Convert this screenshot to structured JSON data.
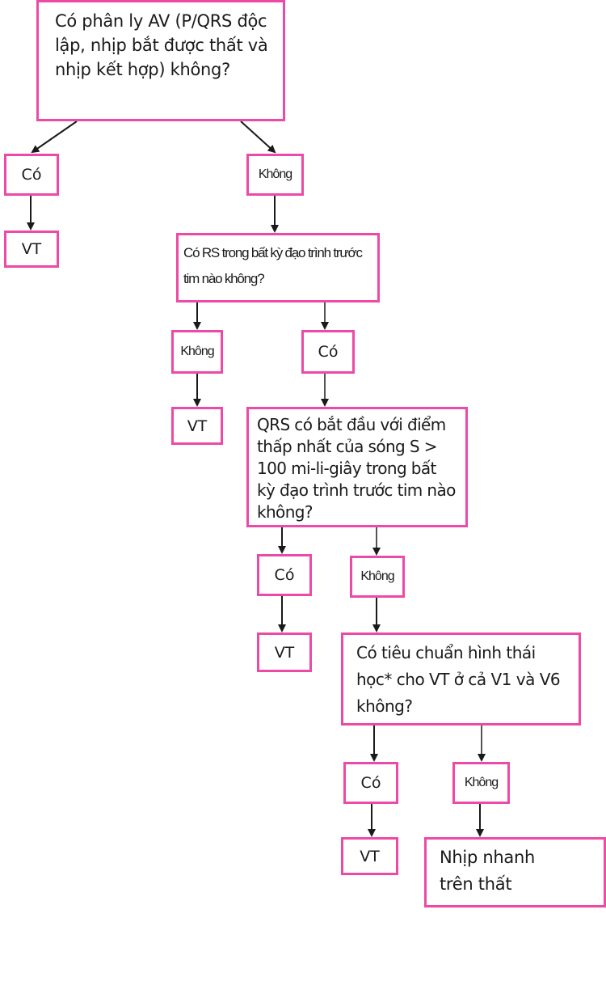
{
  "diagram": {
    "type": "flowchart",
    "accent_color": "#ec4aa6",
    "nodes": {
      "q1": "Có phân ly AV (P/QRS độc lập, nhịp bắt được thất và nhịp kết hợp) không?",
      "q1_yes": "Có",
      "q1_yes_result": "VT",
      "q1_no": "Không",
      "q2": "Có RS trong bất kỳ đạo trình trước tim nào không?",
      "q2_no": "Không",
      "q2_no_result": "VT",
      "q2_yes": "Có",
      "q3": "QRS có bắt đầu với điểm thấp nhất của sóng S > 100 mi-li-giây trong bất kỳ đạo trình trước tim nào không?",
      "q3_yes": "Có",
      "q3_yes_result": "VT",
      "q3_no": "Không",
      "q4": "Có tiêu chuẩn hình thái học* cho VT ở cả V1 và V6 không?",
      "q4_yes": "Có",
      "q4_yes_result": "VT",
      "q4_no": "Không",
      "q4_no_result": "Nhịp nhanh trên thất"
    }
  }
}
